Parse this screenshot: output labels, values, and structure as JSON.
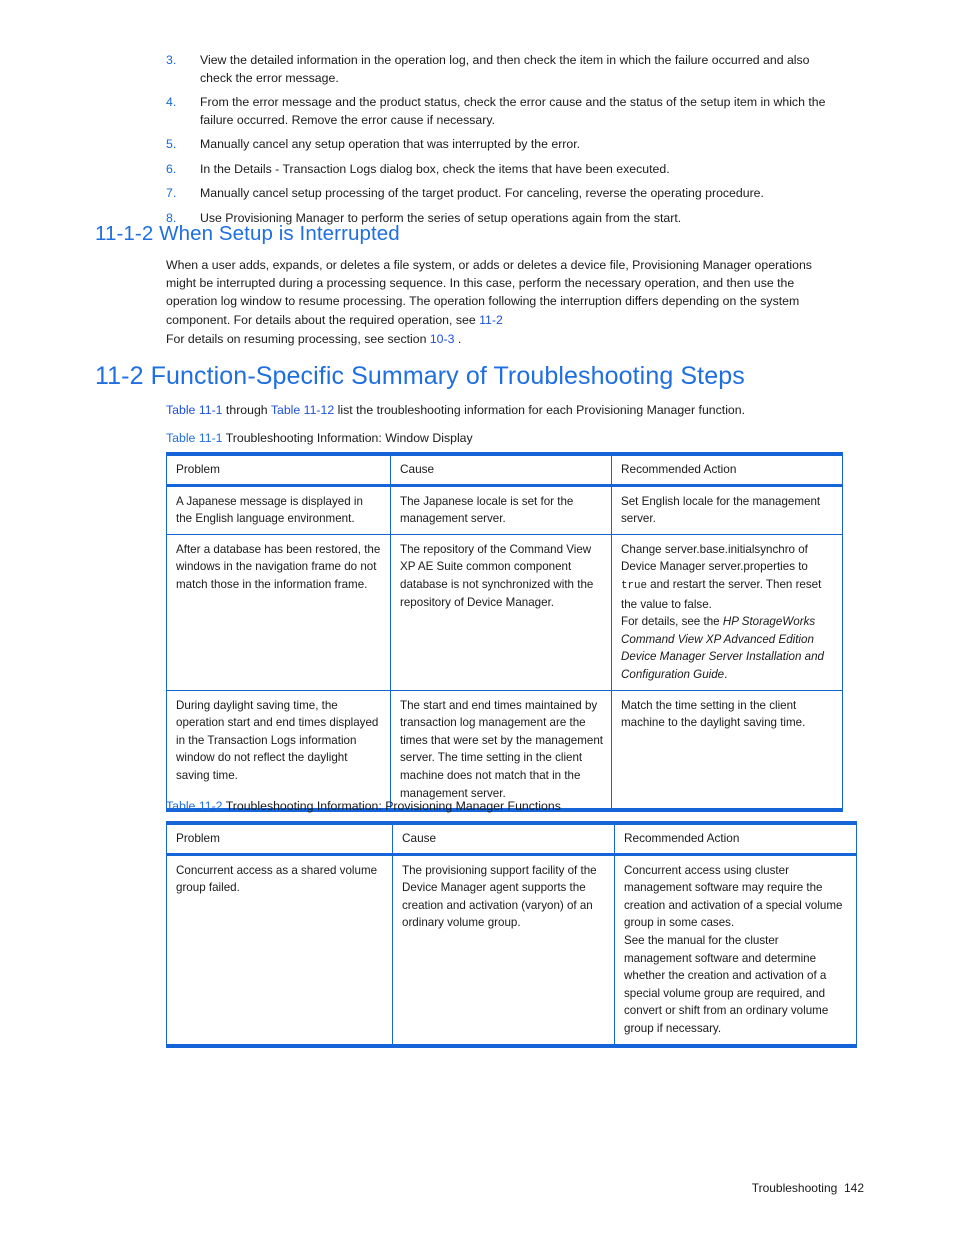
{
  "steps": [
    {
      "num": "3.",
      "text": "View the detailed information in the operation log, and then check the item in which the failure occurred and also check the error message."
    },
    {
      "num": "4.",
      "text": "From the error message and the product status, check the error cause and the status of the setup item in which the failure occurred. Remove the error cause if necessary."
    },
    {
      "num": "5.",
      "text": "Manually cancel any setup operation that was interrupted by the error."
    },
    {
      "num": "6.",
      "text": "In the Details - Transaction Logs dialog box, check the items that have been executed."
    },
    {
      "num": "7.",
      "text": "Manually cancel setup processing of the target product. For canceling, reverse the operating procedure."
    },
    {
      "num": "8.",
      "text": "Use Provisioning Manager to perform the series of setup operations again from the start."
    }
  ],
  "section_11_1_2": {
    "heading": "11-1-2 When Setup is Interrupted",
    "para1_before": "When a user adds, expands, or deletes a file system, or adds or deletes a device file, Provisioning Manager operations might be interrupted during a processing sequence. In this case, perform the necessary operation, and then use the operation log window to resume processing. The operation following the interruption differs depending on the system component. For details about the required operation, see ",
    "para1_link": "11-2",
    "para2_before": "For details on resuming processing, see section ",
    "para2_link": "10-3",
    "para2_after": " ."
  },
  "section_11_2": {
    "heading": "11-2 Function-Specific Summary of Troubleshooting Steps",
    "intro_link1": "Table 11-1",
    "intro_mid": " through ",
    "intro_link2": "Table 11-12",
    "intro_after": " list the troubleshooting information for each Provisioning Manager function."
  },
  "table1": {
    "caption_label": "Table 11-1",
    "caption_text": " Troubleshooting Information: Window Display",
    "columns": [
      "Problem",
      "Cause",
      "Recommended Action"
    ],
    "rows": [
      {
        "problem": "A Japanese message is displayed in the English language environment.",
        "cause": "The Japanese locale is set for the management server.",
        "action_p1_a": "Set English locale for the management server."
      },
      {
        "problem": "After a database has been restored, the windows in the navigation frame do not match those in the information frame.",
        "cause": "The repository of the Command View XP AE Suite common component database is not synchronized with the repository of Device Manager.",
        "action_p1_a": "Change server.base.initialsynchro of Device Manager server.properties to ",
        "action_p1_mono": "true",
        "action_p1_b": " and restart the server. Then reset the value to false.",
        "action_p2_a": "For details, see the ",
        "action_p2_italic": "HP StorageWorks Command View XP Advanced Edition Device Manager Server Installation and Configuration Guide",
        "action_p2_b": "."
      },
      {
        "problem": "During daylight saving time, the operation start and end times displayed in the Transaction Logs information window do not reflect the daylight saving time.",
        "cause": "The start and end times maintained by transaction log management are the times that were set by the management server. The time setting in the client machine does not match that in the management server.",
        "action_p1_a": "Match the time setting in the client machine to the daylight saving time."
      }
    ]
  },
  "table2": {
    "caption_label": "Table 11-2",
    "caption_text": " Troubleshooting Information: Provisioning Manager Functions",
    "columns": [
      "Problem",
      "Cause",
      "Recommended Action"
    ],
    "rows": [
      {
        "problem": "Concurrent access as a shared volume group failed.",
        "cause": "The provisioning support facility of the Device Manager agent supports the creation and activation (varyon) of an ordinary volume group.",
        "action_p1_a": "Concurrent access using cluster management software may require the creation and activation of a special volume group in some cases.",
        "action_p2_a": "See the manual for the cluster management software and determine whether the creation and activation of a special volume group are required, and convert or shift from an ordinary volume group if necessary."
      }
    ]
  },
  "footer": {
    "text": "Troubleshooting  142"
  }
}
